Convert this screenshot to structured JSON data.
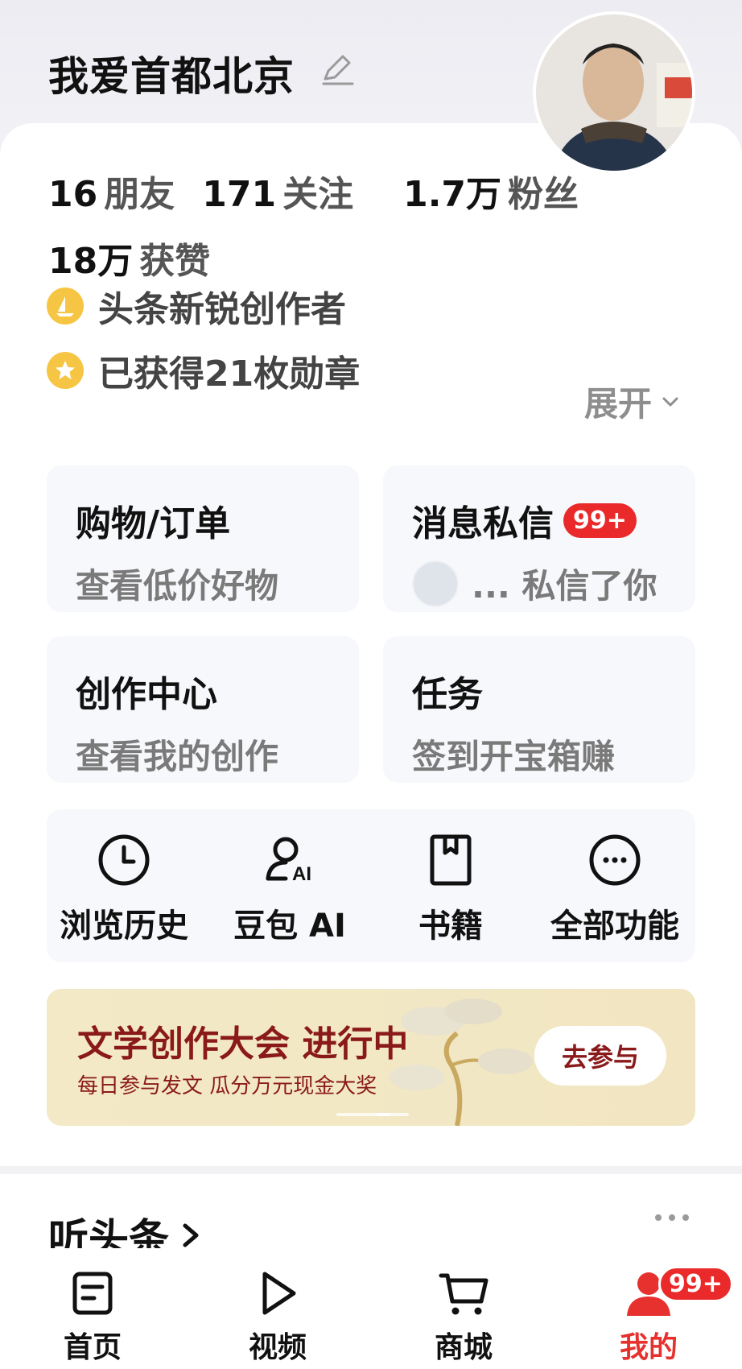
{
  "profile": {
    "username": "我爱首都北京",
    "stats": [
      {
        "num": "16",
        "label": "朋友"
      },
      {
        "num": "171",
        "label": "关注"
      },
      {
        "num": "1.7万",
        "label": "粉丝"
      }
    ],
    "likes": {
      "num": "18万",
      "label": "获赞"
    },
    "badges": [
      {
        "text": "头条新锐创作者",
        "icon": "sail-badge-icon"
      },
      {
        "text": "已获得21枚勋章",
        "icon": "star-medal-icon"
      }
    ],
    "expand_label": "展开"
  },
  "tiles": [
    {
      "title": "购物/订单",
      "sub": "查看低价好物"
    },
    {
      "title": "消息私信",
      "badge": "99+",
      "sub": "... 私信了你"
    },
    {
      "title": "创作中心",
      "sub": "查看我的创作"
    },
    {
      "title": "任务",
      "sub": "签到开宝箱赚"
    }
  ],
  "quick": [
    {
      "label": "浏览历史",
      "icon": "clock-icon"
    },
    {
      "label": "豆包 AI",
      "icon": "ai-person-icon"
    },
    {
      "label": "书籍",
      "icon": "book-icon"
    },
    {
      "label": "全部功能",
      "icon": "more-circle-icon"
    }
  ],
  "banner": {
    "title": "文学创作大会 进行中",
    "sub": "每日参与发文 瓜分万元现金大奖",
    "button": "去参与"
  },
  "section": {
    "title": "听头条"
  },
  "tabbar": {
    "items": [
      {
        "label": "首页",
        "icon": "home-doc-icon"
      },
      {
        "label": "视频",
        "icon": "play-icon"
      },
      {
        "label": "商城",
        "icon": "cart-icon"
      },
      {
        "label": "我的",
        "icon": "person-icon",
        "badge": "99+",
        "active": true
      }
    ]
  },
  "colors": {
    "accent_red": "#e6312e",
    "banner_text": "#8a1a1a",
    "badge_gold": "#f6c544"
  }
}
